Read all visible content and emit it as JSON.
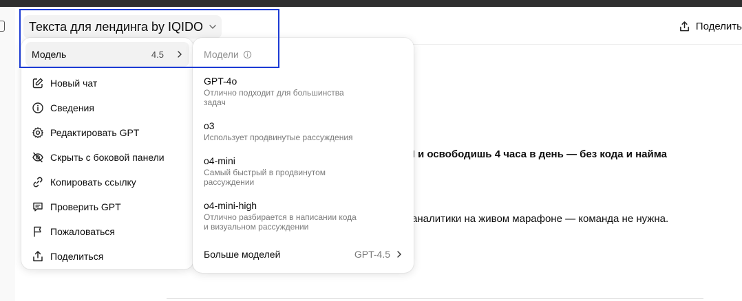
{
  "header": {
    "gpt_title": "Текста для лендинга by IQIDO",
    "share_label": "Поделить"
  },
  "content": {
    "line1": "И и освободишь 4 часа в день — без кода и найма",
    "line2": "аналитики на живом марафоне — команда не нужна."
  },
  "menu": {
    "model_label": "Модель",
    "model_value": "4.5",
    "items": [
      {
        "label": "Новый чат",
        "icon": "edit-icon"
      },
      {
        "label": "Сведения",
        "icon": "info-icon"
      },
      {
        "label": "Редактировать GPT",
        "icon": "gear-icon"
      },
      {
        "label": "Скрыть с боковой панели",
        "icon": "eye-off-icon"
      },
      {
        "label": "Копировать ссылку",
        "icon": "link-icon"
      },
      {
        "label": "Проверить GPT",
        "icon": "chat-check-icon"
      },
      {
        "label": "Пожаловаться",
        "icon": "flag-icon"
      },
      {
        "label": "Поделиться",
        "icon": "share-icon"
      }
    ]
  },
  "submenu": {
    "header": "Модели",
    "models": [
      {
        "name": "GPT-4o",
        "desc": "Отлично подходит для большинства\nзадач"
      },
      {
        "name": "o3",
        "desc": "Использует продвинутые рассуждения"
      },
      {
        "name": "o4-mini",
        "desc": "Самый быстрый в продвинутом\nрассуждении"
      },
      {
        "name": "o4-mini-high",
        "desc": "Отлично разбирается в написании кода\nи визуальном рассуждении"
      }
    ],
    "more_label": "Больше моделей",
    "more_value": "GPT-4.5"
  },
  "colors": {
    "highlight": "#1c3bd4",
    "topbar": "#2f2f2f"
  }
}
